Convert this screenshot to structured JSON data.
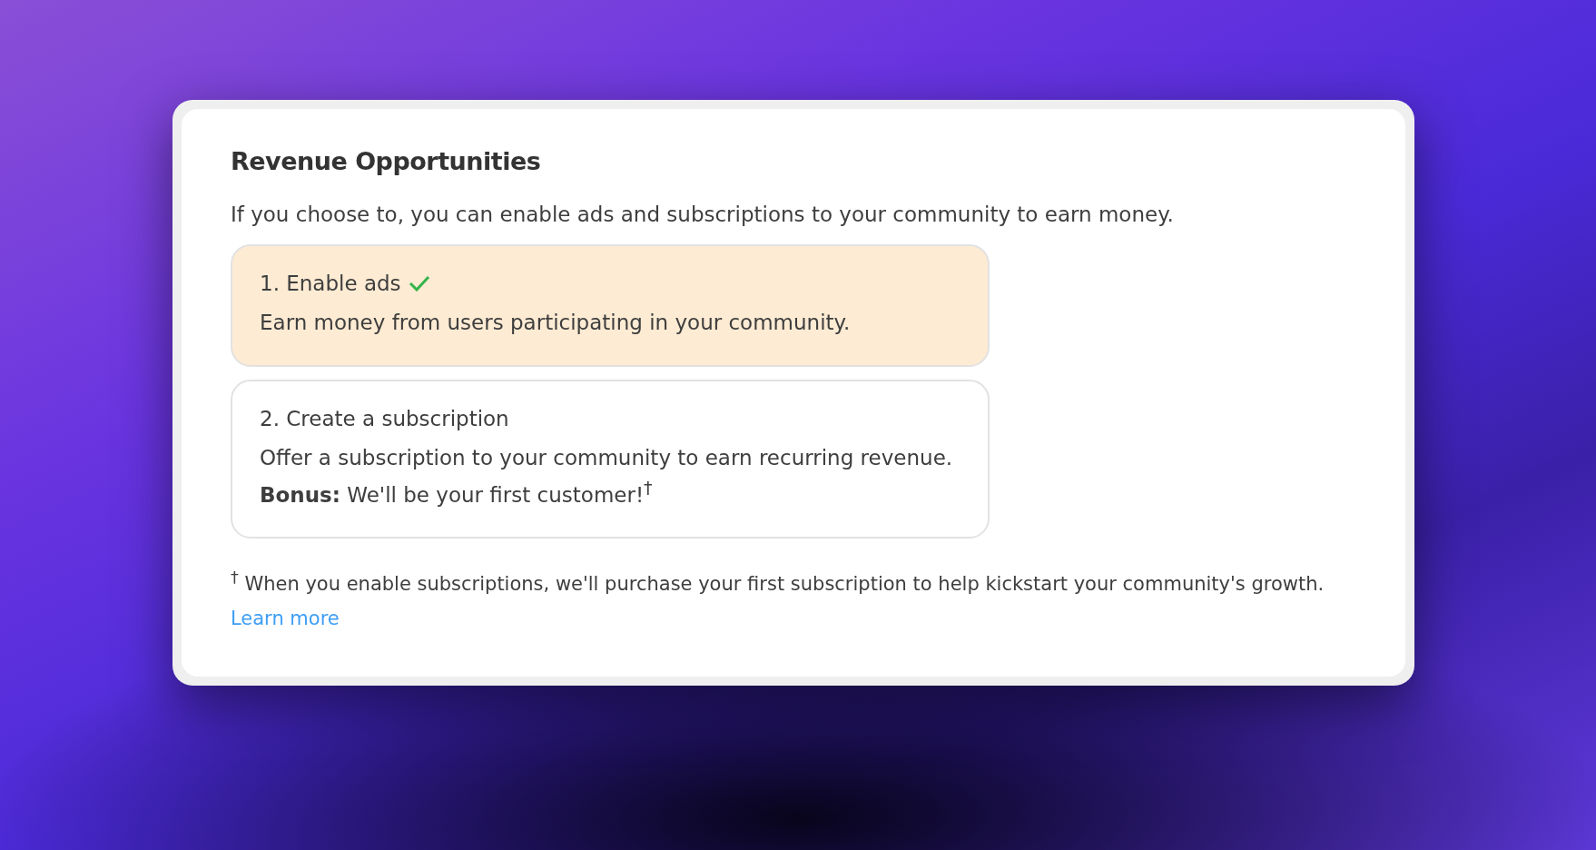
{
  "card": {
    "title": "Revenue Opportunities",
    "description": "If you choose to, you can enable ads and subscriptions to your community to earn money.",
    "options": [
      {
        "title": "1. Enable ads",
        "body": "Earn money from users participating in your community.",
        "completed": true
      },
      {
        "title": "2. Create a subscription",
        "body": "Offer a subscription to your community to earn recurring revenue. **Bonus:** We'll be your first customer!$^{†}$",
        "completed": false
      }
    ],
    "footnote": {
      "text": "$^{†}$ When you enable subscriptions, we'll purchase your first subscription to help kickstart your community's growth.",
      "link": "Learn more"
    }
  }
}
